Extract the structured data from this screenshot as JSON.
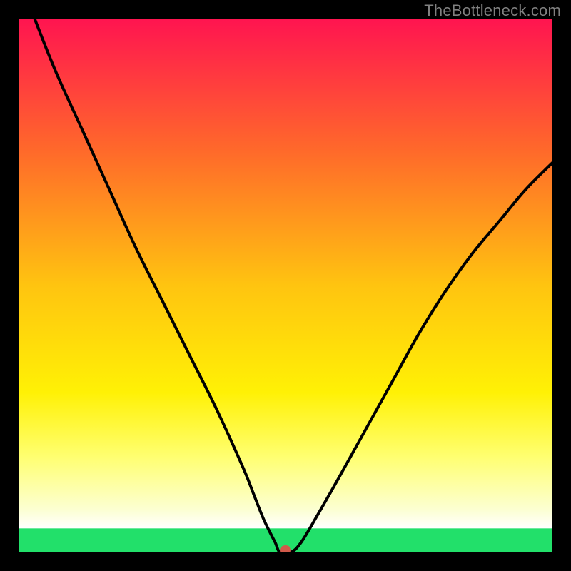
{
  "credit": "TheBottleneck.com",
  "chart_data": {
    "type": "line",
    "title": "",
    "xlabel": "",
    "ylabel": "",
    "xlim": [
      0,
      100
    ],
    "ylim": [
      0,
      100
    ],
    "x": [
      3,
      7,
      12,
      17,
      22,
      27,
      32,
      37,
      42,
      44,
      46,
      48,
      49,
      51,
      53,
      56,
      60,
      65,
      70,
      75,
      80,
      85,
      90,
      95,
      100
    ],
    "values": [
      100,
      90,
      79,
      68,
      57,
      47,
      37,
      27,
      16,
      11,
      6,
      2,
      0,
      0,
      2,
      7,
      14,
      23,
      32,
      41,
      49,
      56,
      62,
      68,
      73
    ],
    "minimum_marker": {
      "x": 50,
      "y": 0
    },
    "green_band_top": 4.5,
    "gradient_stops": [
      {
        "offset": 0,
        "color": "#ff1450"
      },
      {
        "offset": 0.25,
        "color": "#ff6a2a"
      },
      {
        "offset": 0.5,
        "color": "#ffc410"
      },
      {
        "offset": 0.7,
        "color": "#fff105"
      },
      {
        "offset": 0.82,
        "color": "#ffff70"
      },
      {
        "offset": 0.92,
        "color": "#fcffd2"
      },
      {
        "offset": 0.955,
        "color": "#ffffff"
      },
      {
        "offset": 0.97,
        "color": "#a8f7c1"
      },
      {
        "offset": 1.0,
        "color": "#22e06a"
      }
    ]
  }
}
